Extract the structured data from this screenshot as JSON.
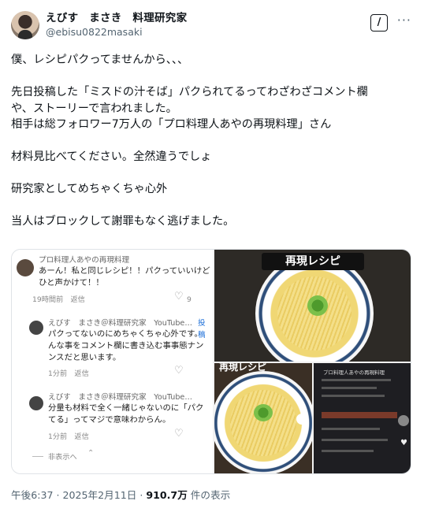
{
  "post": {
    "display_name": "えびす　まさき　料理研究家",
    "handle": "@ebisu0822masaki",
    "grok_icon": "grok-icon",
    "more_icon": "more-horizontal-icon",
    "body_lines": [
      "僕、レシピパクってませんから、、、",
      "",
      "先日投稿した「ミスドの汁そば」パクられてるってわざわざコメント欄",
      "や、ストーリーで言われました。",
      "相手は総フォロワー7万人の「プロ料理人あやの再現料理」さん",
      "",
      "材料見比べてください。全然違うでしょ",
      "",
      "研究家としてめちゃくちゃ心外",
      "",
      "当人はブロックして謝罪もなく逃げました。"
    ]
  },
  "media": {
    "comments": [
      {
        "name": "プロ料理人あやの再現料理",
        "lines": [
          "あーん！私と同じレシピ！！パクっていいけど",
          "ひと声かけて！！"
        ],
        "meta": "19時間前　返信",
        "likes": "9"
      },
      {
        "name": "えびす　まさき＠料理研究家　YouTube…",
        "badge": "投稿",
        "lines": [
          "パクってないのにめちゃくちゃ心外です。",
          "んな事をコメント欄に書き込む事事態ナン",
          "ンスだと思います。"
        ],
        "meta": "1分前　返信"
      },
      {
        "name": "えびす　まさき＠料理研究家　YouTube…",
        "lines": [
          "分量も材料で全く一緒じゃないのに「パク",
          "てる」ってマジで意味わからん。"
        ],
        "meta": "1分前　返信"
      }
    ],
    "hide_replies": "非表示へ",
    "recipe_banner": "再現レシピ",
    "thumb_left_banner": "再現レシピ",
    "thumb_right_title": "プロ料理人あやの再現料理"
  },
  "footer": {
    "time": "午後6:37 · 2025年2月11日 · ",
    "views": "910.7万",
    "views_suffix": " 件の表示"
  }
}
